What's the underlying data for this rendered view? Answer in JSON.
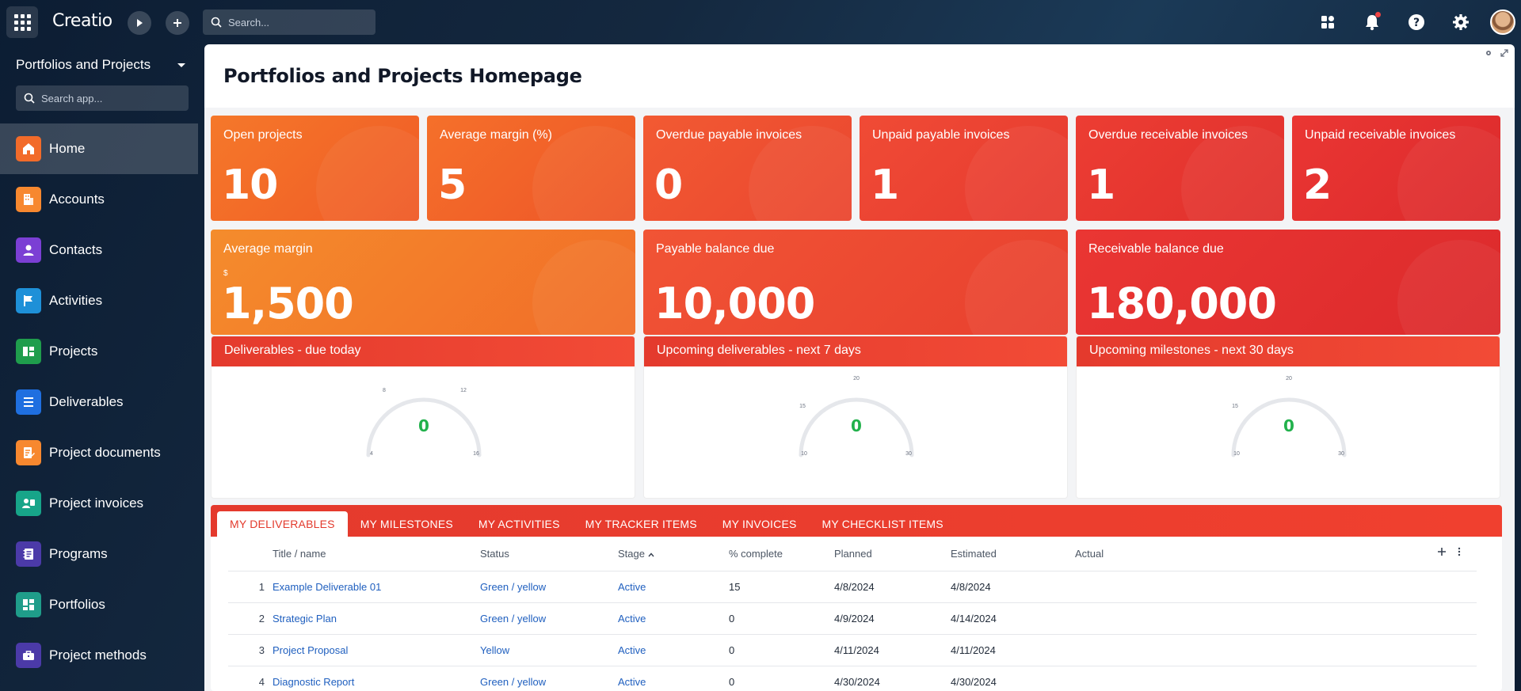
{
  "topbar": {
    "logo": "Creatio",
    "search_placeholder": "Search...",
    "icons": [
      "apps-grid-icon",
      "run-process-icon",
      "add-icon",
      "search-icon",
      "dashboards-icon",
      "bell-icon",
      "help-icon",
      "gear-icon",
      "user-avatar"
    ]
  },
  "sidebar": {
    "app_title": "Portfolios and Projects",
    "search_placeholder": "Search app...",
    "items": [
      {
        "label": "Home",
        "icon": "home-icon",
        "color": "#f26b2a"
      },
      {
        "label": "Accounts",
        "icon": "building-icon",
        "color": "#f7882f"
      },
      {
        "label": "Contacts",
        "icon": "person-icon",
        "color": "#7b3fd4"
      },
      {
        "label": "Activities",
        "icon": "flag-icon",
        "color": "#1e90d8"
      },
      {
        "label": "Projects",
        "icon": "projects-icon",
        "color": "#1f9d4c"
      },
      {
        "label": "Deliverables",
        "icon": "list-icon",
        "color": "#1f6fe0"
      },
      {
        "label": "Project documents",
        "icon": "document-edit-icon",
        "color": "#f7882f"
      },
      {
        "label": "Project invoices",
        "icon": "people-invoice-icon",
        "color": "#17a589"
      },
      {
        "label": "Programs",
        "icon": "notebook-icon",
        "color": "#4b3aa8"
      },
      {
        "label": "Portfolios",
        "icon": "portfolio-grid-icon",
        "color": "#1f9d8a"
      },
      {
        "label": "Project methods",
        "icon": "briefcase-icon",
        "color": "#4b3aa8"
      }
    ]
  },
  "main": {
    "title": "Portfolios and Projects Homepage",
    "kpis": [
      {
        "label": "Open projects",
        "value": "10"
      },
      {
        "label": "Average margin (%)",
        "value": "5"
      },
      {
        "label": "Overdue payable invoices",
        "value": "0"
      },
      {
        "label": "Unpaid payable invoices",
        "value": "1"
      },
      {
        "label": "Overdue receivable invoices",
        "value": "1"
      },
      {
        "label": "Unpaid receivable invoices",
        "value": "2"
      }
    ],
    "wide_kpis": [
      {
        "label": "Average margin",
        "currency": "$",
        "value": "1,500"
      },
      {
        "label": "Payable balance due",
        "value": "10,000"
      },
      {
        "label": "Receivable balance due",
        "value": "180,000"
      }
    ],
    "gauges": [
      {
        "title": "Deliverables - due today",
        "value": "0",
        "ticks": [
          "4",
          "8",
          "12",
          "16"
        ]
      },
      {
        "title": "Upcoming deliverables - next 7 days",
        "value": "0",
        "ticks": [
          "10",
          "15",
          "20",
          "30"
        ]
      },
      {
        "title": "Upcoming milestones - next 30 days",
        "value": "0",
        "ticks": [
          "10",
          "15",
          "20",
          "30"
        ]
      }
    ],
    "tabs": [
      "MY DELIVERABLES",
      "MY MILESTONES",
      "MY ACTIVITIES",
      "MY TRACKER ITEMS",
      "MY INVOICES",
      "MY CHECKLIST ITEMS"
    ],
    "grid": {
      "columns": [
        "Title / name",
        "Status",
        "Stage",
        "% complete",
        "Planned",
        "Estimated",
        "Actual"
      ],
      "rows": [
        {
          "num": "1",
          "title": "Example Deliverable 01",
          "status": "Green / yellow",
          "stage": "Active",
          "pct": "15",
          "planned": "4/8/2024",
          "estimated": "4/8/2024",
          "actual": ""
        },
        {
          "num": "2",
          "title": "Strategic Plan",
          "status": "Green / yellow",
          "stage": "Active",
          "pct": "0",
          "planned": "4/9/2024",
          "estimated": "4/14/2024",
          "actual": ""
        },
        {
          "num": "3",
          "title": "Project Proposal",
          "status": "Yellow",
          "stage": "Active",
          "pct": "0",
          "planned": "4/11/2024",
          "estimated": "4/11/2024",
          "actual": ""
        },
        {
          "num": "4",
          "title": "Diagnostic Report",
          "status": "Green / yellow",
          "stage": "Active",
          "pct": "0",
          "planned": "4/30/2024",
          "estimated": "4/30/2024",
          "actual": ""
        }
      ]
    }
  },
  "colors": {
    "accent_red": "#e33a2c",
    "orange": "#f7882f",
    "gauge_value_green": "#22b14c",
    "link_blue": "#1f5fbf"
  }
}
